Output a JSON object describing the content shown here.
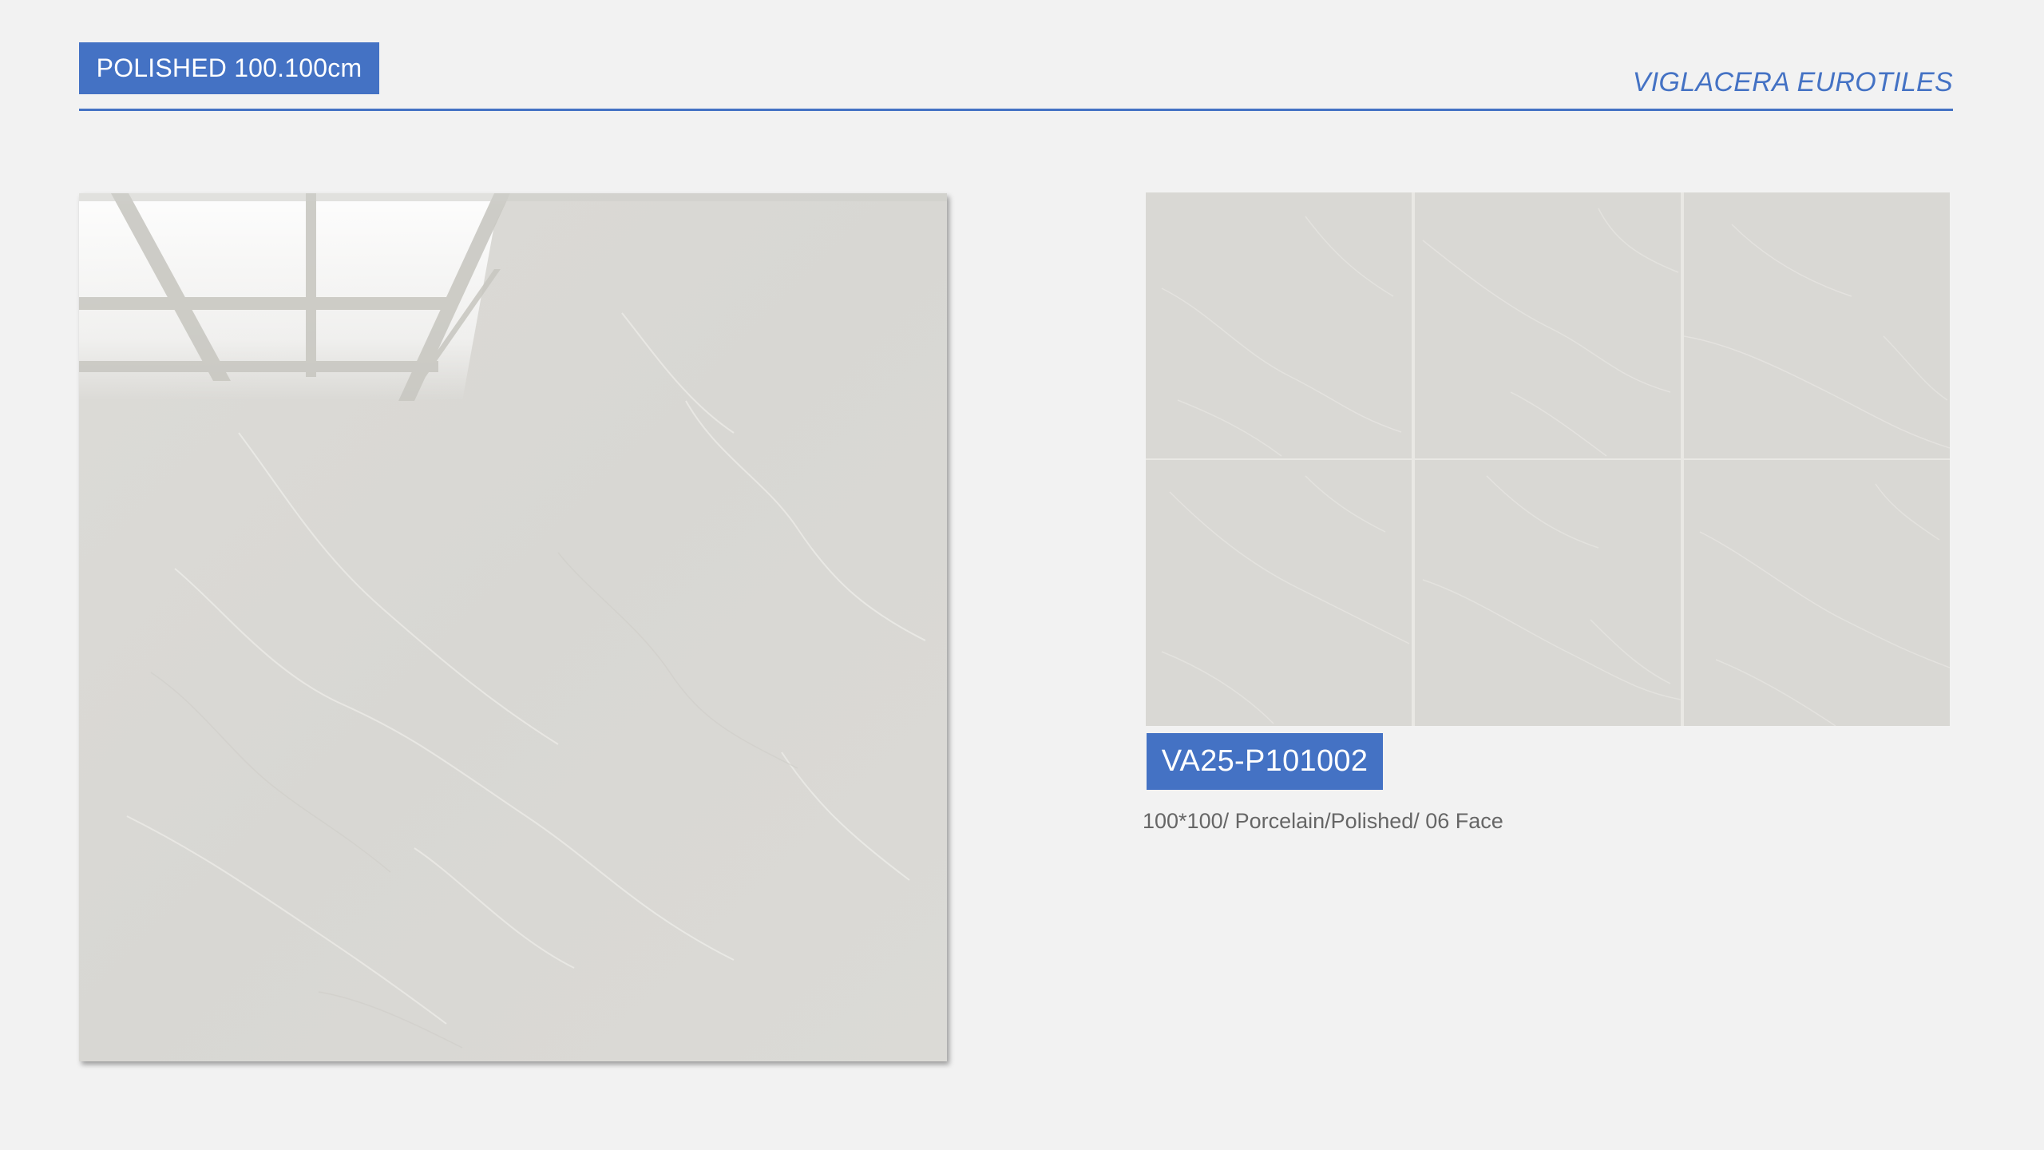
{
  "header": {
    "title_badge": "POLISHED 100.100cm",
    "brand": "VIGLACERA EUROTILES"
  },
  "product": {
    "code": "VA25-P101002",
    "spec": "100*100/ Porcelain/Polished/ 06 Face"
  },
  "colors": {
    "accent": "#4472c4",
    "background": "#f2f2f2",
    "tile": "#d9d8d4",
    "spec_text": "#666666"
  }
}
